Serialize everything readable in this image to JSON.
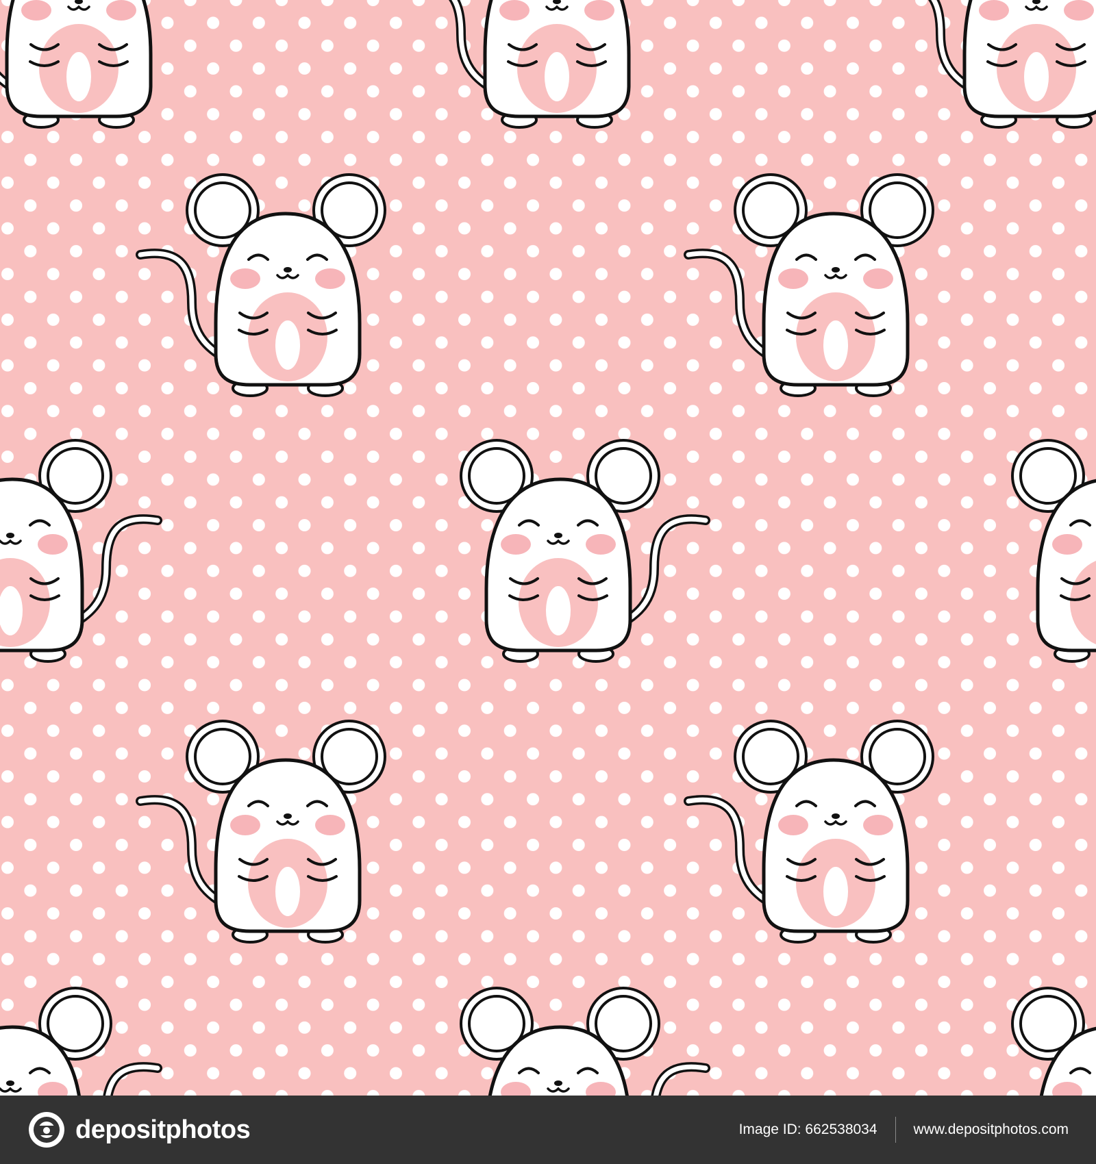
{
  "colors": {
    "background": "#f9c0bf",
    "dot": "#ffffff",
    "mouse_body": "#ffffff",
    "outline": "#111111",
    "cheek": "#f7b5b9",
    "belly": "#f9c0c0",
    "footer": "#333333",
    "footer_text": "#ffffff"
  },
  "pattern": {
    "subject": "kawaii mouse",
    "icon": "mouse-icon",
    "dot_icon": "polka-dot"
  },
  "footer": {
    "brand_icon": "depositphotos-logo-icon",
    "brand_name": "depositphotos",
    "image_id_label": "Image ID: 662538034",
    "site_url": "www.depositphotos.com"
  }
}
